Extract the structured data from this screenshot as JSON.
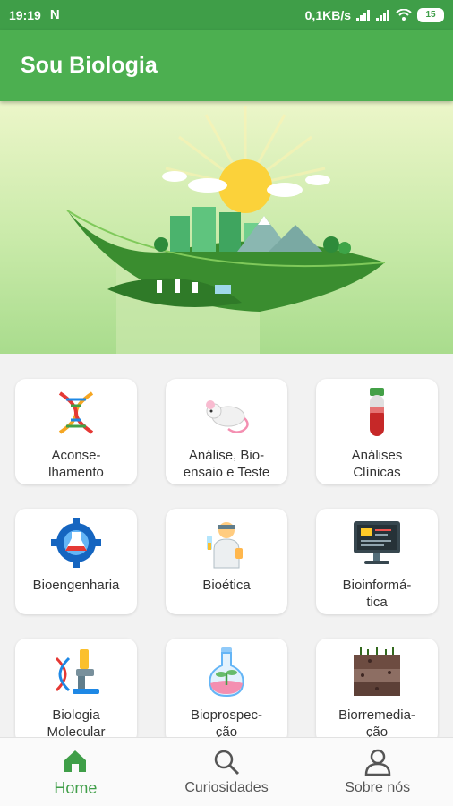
{
  "status_bar": {
    "time": "19:19",
    "notification_icon": "N",
    "net_speed": "0,1KB/s",
    "battery_level": "15",
    "icons": [
      "signal-icon",
      "signal-icon",
      "wifi-icon",
      "battery-icon"
    ]
  },
  "app_bar": {
    "title": "Sou Biologia"
  },
  "hero": {
    "image": "leaf-with-city-and-sun-illustration"
  },
  "categories": [
    {
      "label": "Aconse-\nlhamento",
      "icon": "dna-icon"
    },
    {
      "label": "Análise, Bio-\nensaio e Teste",
      "icon": "lab-mouse-icon"
    },
    {
      "label": "Análises\nClínicas",
      "icon": "blood-test-tube-icon"
    },
    {
      "label": "Bioengenharia",
      "icon": "gear-flask-icon"
    },
    {
      "label": "Bioética",
      "icon": "scientist-icon"
    },
    {
      "label": "Bioinformá-\ntica",
      "icon": "computer-monitor-icon"
    },
    {
      "label": "Biologia\nMolecular",
      "icon": "dna-microscope-icon"
    },
    {
      "label": "Bioprospec-\nção",
      "icon": "plant-flask-icon"
    },
    {
      "label": "Biorremedia-\nção",
      "icon": "soil-layers-icon"
    }
  ],
  "bottom_nav": [
    {
      "label": "Home",
      "icon": "home-icon",
      "active": true
    },
    {
      "label": "Curiosidades",
      "icon": "search-icon",
      "active": false
    },
    {
      "label": "Sobre nós",
      "icon": "person-icon",
      "active": false
    }
  ],
  "colors": {
    "primary": "#4caf50",
    "status_bar": "#3f9e48",
    "active_nav": "#3f9e48"
  }
}
